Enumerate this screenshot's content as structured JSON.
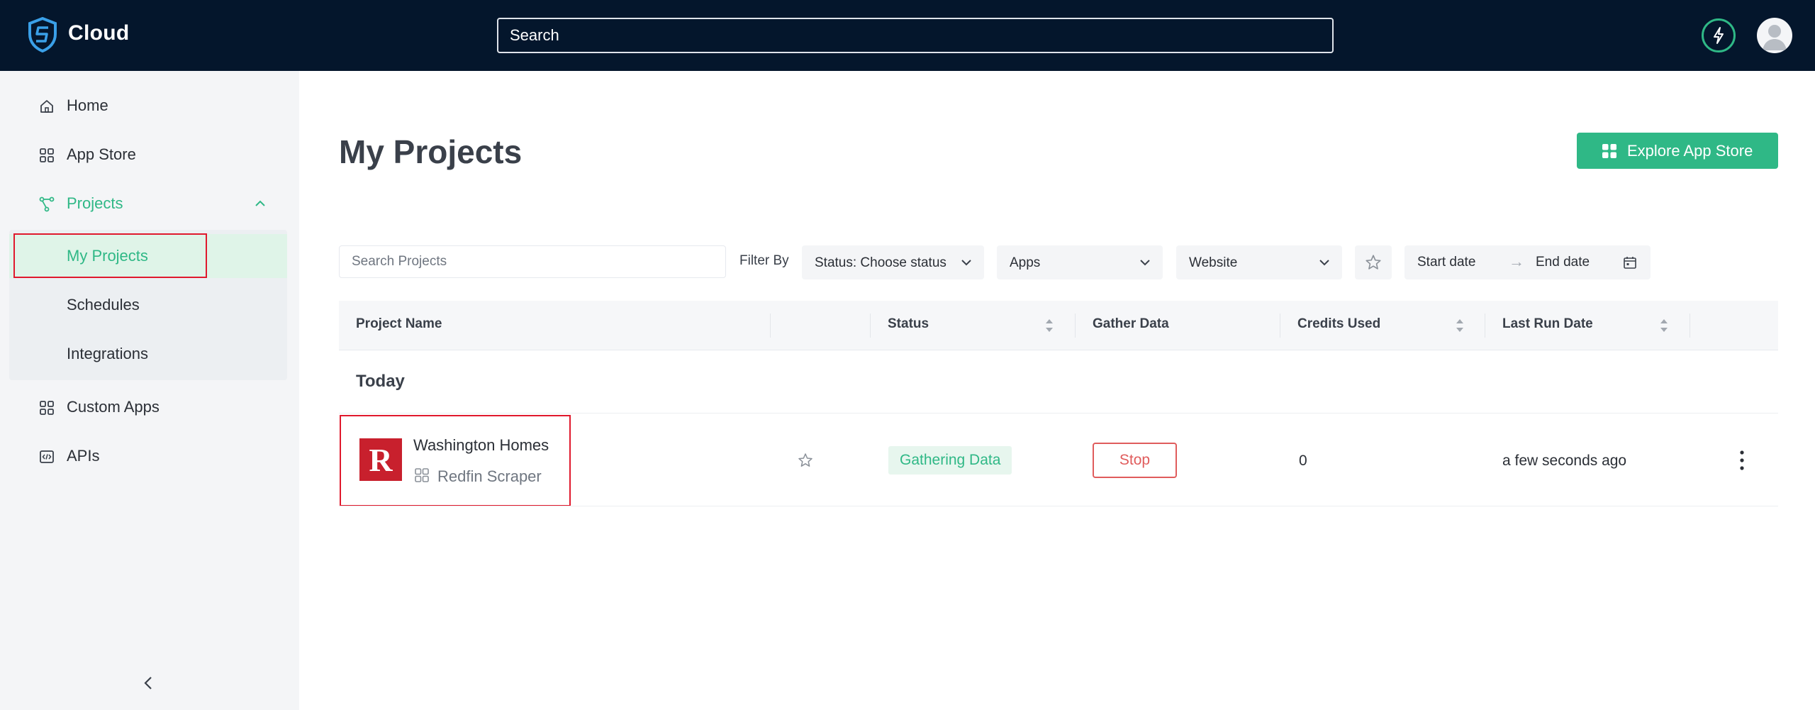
{
  "header": {
    "brand": "Cloud",
    "search_placeholder": "Search",
    "icons": [
      "shield-logo-icon",
      "lightning-icon",
      "user-avatar-icon"
    ]
  },
  "sidebar": {
    "items": [
      {
        "label": "Home",
        "icon": "home-icon"
      },
      {
        "label": "App Store",
        "icon": "grid-icon"
      },
      {
        "label": "Projects",
        "icon": "projects-icon",
        "expanded": true
      },
      {
        "label": "Custom Apps",
        "icon": "custom-apps-icon"
      },
      {
        "label": "APIs",
        "icon": "code-icon"
      }
    ],
    "subitems": [
      {
        "label": "My Projects",
        "active": true
      },
      {
        "label": "Schedules"
      },
      {
        "label": "Integrations"
      }
    ]
  },
  "main": {
    "title": "My Projects",
    "explore_button": "Explore App Store",
    "search_placeholder": "Search Projects",
    "filter_by": "Filter By",
    "filters": {
      "status": "Status: Choose status",
      "apps": "Apps",
      "website": "Website",
      "start_date": "Start date",
      "arrow": "→",
      "end_date": "End date"
    },
    "columns": [
      "Project Name",
      "Status",
      "Gather Data",
      "Credits Used",
      "Last Run Date"
    ],
    "groups": [
      {
        "title": "Today",
        "rows": [
          {
            "project_name": "Washington Homes",
            "app_logo_letter": "R",
            "app_name": "Redfin Scraper",
            "status": "Gathering Data",
            "gather_action": "Stop",
            "credits_used": "0",
            "last_run": "a few seconds ago"
          }
        ]
      }
    ]
  },
  "colors": {
    "topbar": "#04162c",
    "accent": "#2fb886",
    "danger": "#e05c5c",
    "highlight": "#e0192d",
    "sidebar_bg": "#f4f5f7",
    "redfin": "#c8202d"
  }
}
